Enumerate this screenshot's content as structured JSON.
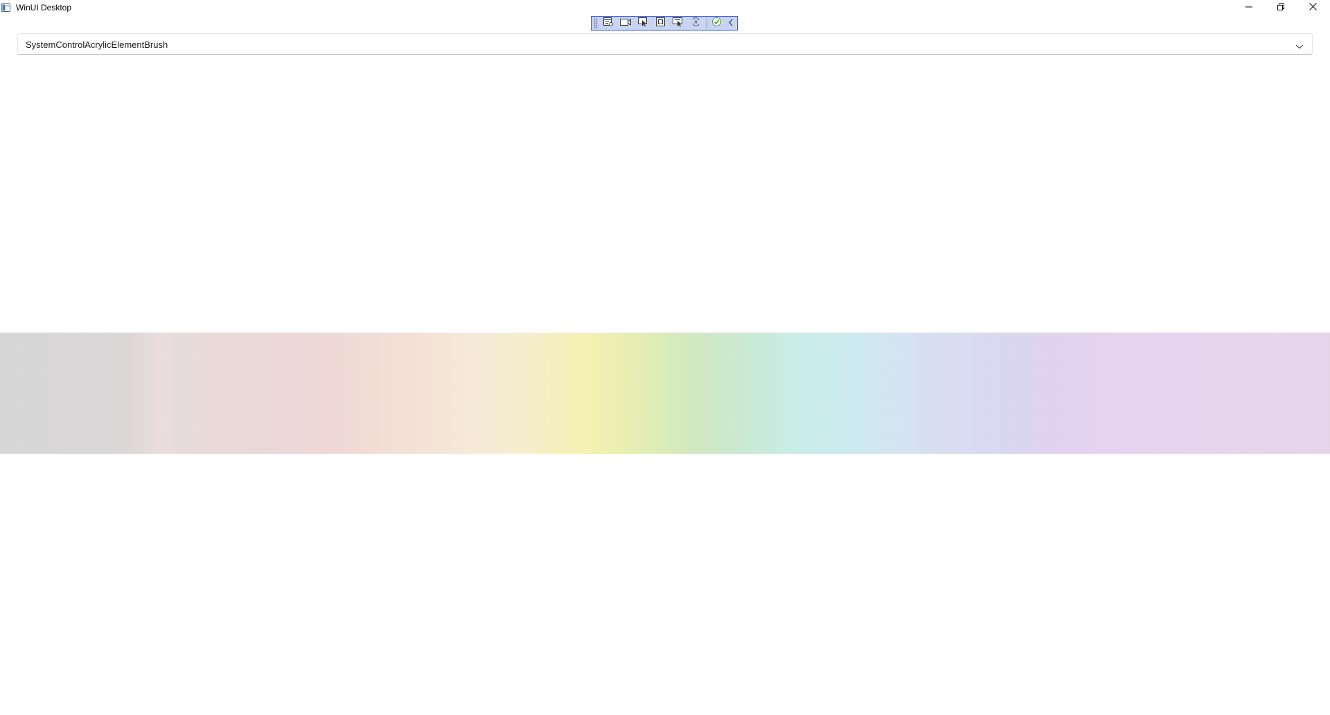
{
  "window": {
    "title": "WinUI Desktop",
    "icons": {
      "app": "app-window-icon",
      "minimize": "minimize-icon",
      "maximize": "restore-icon",
      "close": "close-icon"
    }
  },
  "debug_toolbar": {
    "buttons": [
      {
        "name": "go-to-live-visual-tree-icon"
      },
      {
        "name": "video-camera-icon"
      },
      {
        "name": "select-element-icon"
      },
      {
        "name": "display-layout-adorners-icon"
      },
      {
        "name": "track-focused-element-icon"
      },
      {
        "name": "hot-reload-icon"
      },
      {
        "name": "check-accessibility-icon"
      },
      {
        "name": "collapse-chevron-icon"
      }
    ],
    "colors": {
      "background": "#c9d4f2",
      "border": "#3b4fa6"
    }
  },
  "combobox": {
    "selected_value": "SystemControlAcrylicElementBrush",
    "chevron_icon": "chevron-down-icon"
  },
  "acrylic_band": {
    "colors": [
      "#d6d6d6",
      "#ead8d7",
      "#f5ead7",
      "#f4f1b0",
      "#d0e8c0",
      "#c8ede8",
      "#d5e2f1",
      "#d9d6f0",
      "#e6d3ef"
    ]
  }
}
